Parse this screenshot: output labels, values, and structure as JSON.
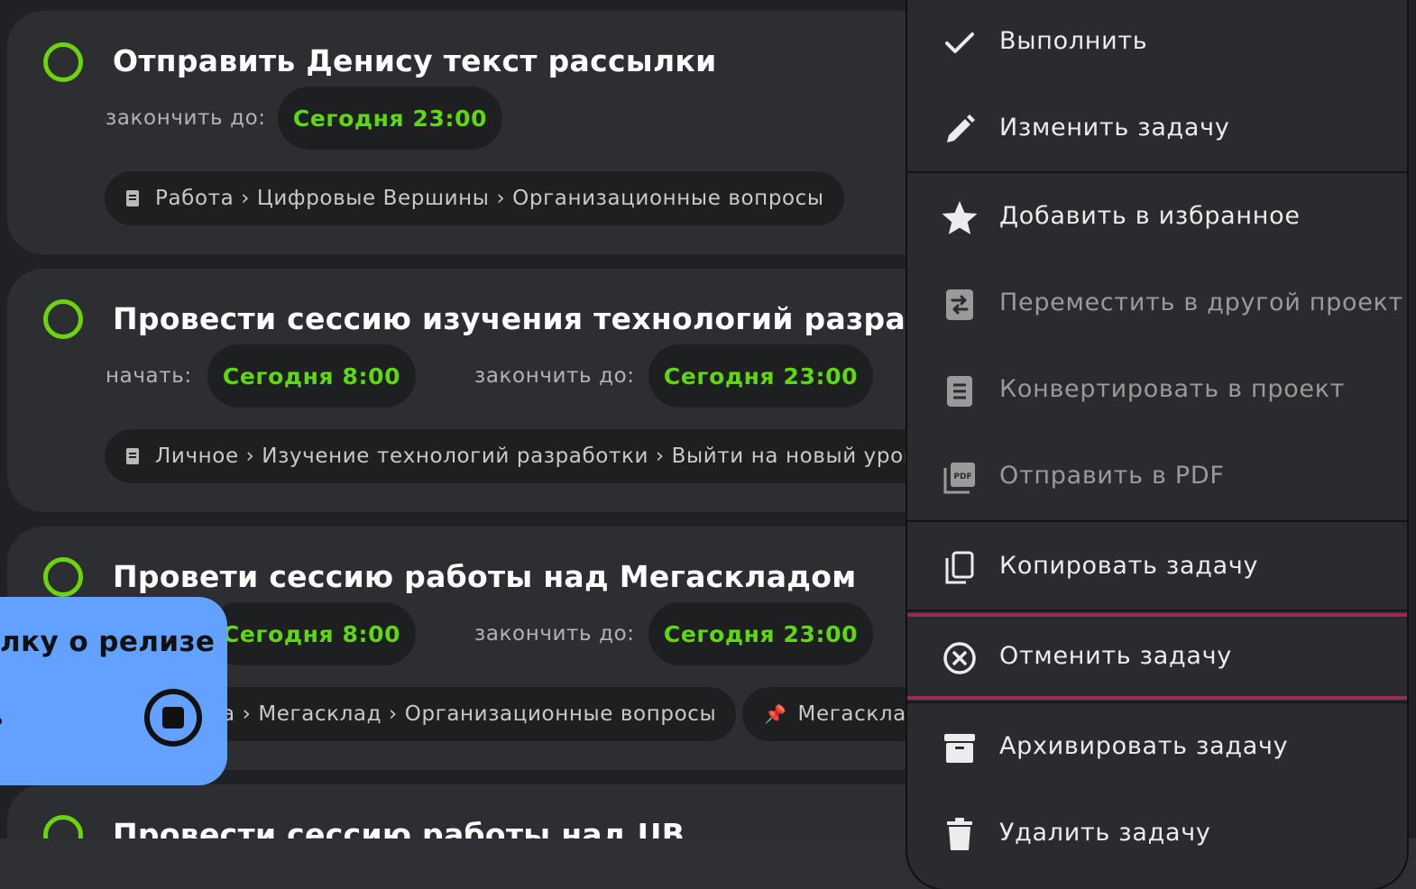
{
  "tasks": [
    {
      "title": "Отправить Денису текст рассылки",
      "end_label": "закончить до:",
      "end_value": "Сегодня 23:00",
      "path": "Работа › Цифровые Вершины › Организационные вопросы"
    },
    {
      "title": "Провести сессию изучения технологий разработки",
      "start_label": "начать:",
      "start_value": "Сегодня 8:00",
      "end_label": "закончить до:",
      "end_value": "Сегодня 23:00",
      "path": "Личное › Изучение технологий разработки › Выйти на новый уровень"
    },
    {
      "title": "Провети сессию работы над Мегаскладом",
      "start_value": "Сегодня 8:00",
      "end_label": "закончить до:",
      "end_value": "Сегодня 23:00",
      "path": "а › Мегасклад › Организационные вопросы",
      "tag": "Мегасклад"
    },
    {
      "title": "Провести сессию работы над UB"
    }
  ],
  "timer": {
    "text": "лку о релизе"
  },
  "menu": {
    "items": [
      {
        "label": "Выполнить",
        "icon": "check-icon",
        "enabled": true
      },
      {
        "label": "Изменить задачу",
        "icon": "pencil-icon",
        "enabled": true
      },
      {
        "label": "Добавить в избранное",
        "icon": "star-icon",
        "enabled": true
      },
      {
        "label": "Переместить в другой проект",
        "icon": "move-icon",
        "enabled": false
      },
      {
        "label": "Конвертировать в проект",
        "icon": "document-icon",
        "enabled": false
      },
      {
        "label": "Отправить в PDF",
        "icon": "pdf-icon",
        "enabled": false
      },
      {
        "label": "Копировать задачу",
        "icon": "copy-icon",
        "enabled": true
      },
      {
        "label": "Отменить задачу",
        "icon": "cancel-circle-icon",
        "enabled": true,
        "highlighted": true
      },
      {
        "label": "Архивировать задачу",
        "icon": "archive-icon",
        "enabled": true
      },
      {
        "label": "Удалить задачу",
        "icon": "trash-icon",
        "enabled": true
      }
    ]
  },
  "colors": {
    "accent_green": "#5fd80f",
    "timer_blue": "#62a1ff",
    "highlight_border": "#9a2a55"
  }
}
